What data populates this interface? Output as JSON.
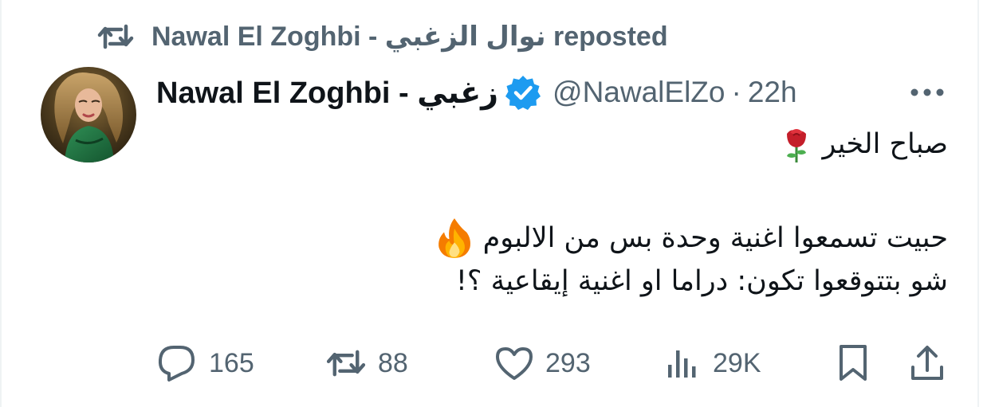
{
  "social_context": {
    "label": "Nawal El Zoghbi - نوال الزغبي reposted",
    "icon": "repost-icon"
  },
  "author": {
    "display_name": "Nawal El Zoghbi - زغبي",
    "handle": "@NawalElZo",
    "separator": "·",
    "time": "22h",
    "verified_icon": "verified-badge-icon",
    "verified_color": "#1d9bf0"
  },
  "tweet": {
    "line1": "صباح الخير",
    "line1_emoji": "rose-emoji",
    "line2": "حبيت تسمعوا اغنية وحدة بس من الالبوم",
    "line2_emoji": "fire-emoji",
    "line3": "شو بتتوقعوا تكون: دراما او اغنية إيقاعية ؟!"
  },
  "actions": {
    "replies": "165",
    "reposts": "88",
    "likes": "293",
    "views": "29K"
  },
  "colors": {
    "text_primary": "#0f1419",
    "text_secondary": "#536471",
    "accent": "#1d9bf0"
  }
}
